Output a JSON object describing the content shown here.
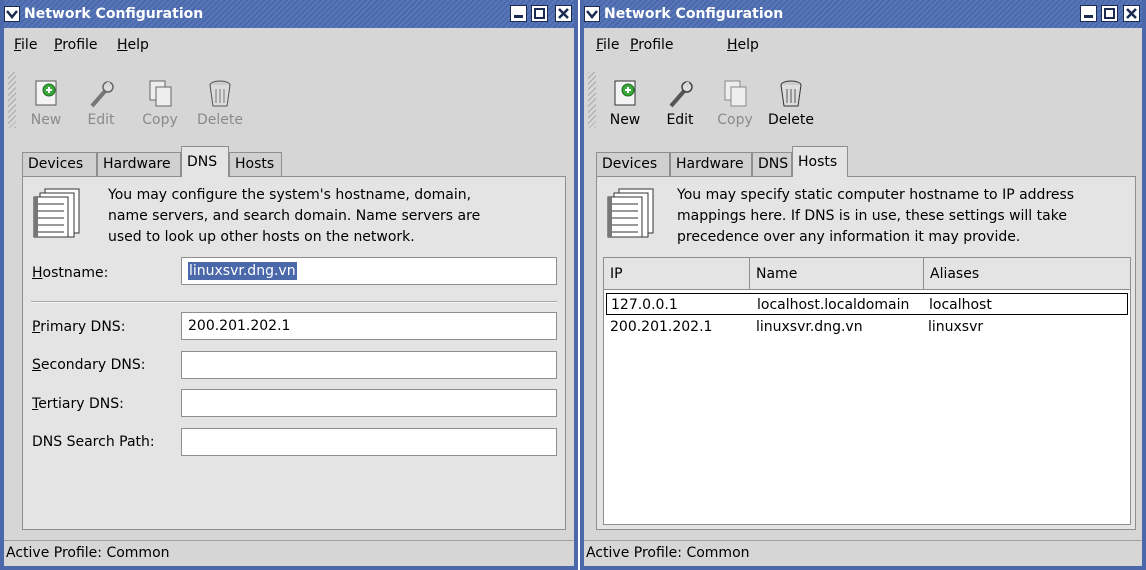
{
  "left_window": {
    "title": "Network Configuration",
    "menu": [
      {
        "label": "File",
        "key": "F",
        "rest": "ile"
      },
      {
        "label": "Profile",
        "key": "P",
        "rest": "rofile"
      },
      {
        "label": "Help",
        "key": "H",
        "rest": "elp"
      }
    ],
    "toolbar": {
      "new": "New",
      "edit": "Edit",
      "copy": "Copy",
      "delete": "Delete"
    },
    "tabs": [
      "Devices",
      "Hardware",
      "DNS",
      "Hosts"
    ],
    "active_tab": "DNS",
    "info_lines": [
      "You may configure the system's hostname, domain,",
      "name servers, and search domain. Name servers are",
      "used to look up other hosts on the network."
    ],
    "form": {
      "hostname_label": "Hostname:",
      "hostname_value": "linuxsvr.dng.vn",
      "primary_label": "Primary DNS:",
      "primary_value": "200.201.202.1",
      "secondary_label": "Secondary DNS:",
      "secondary_value": "",
      "tertiary_label": "Tertiary DNS:",
      "tertiary_value": "",
      "search_label": "DNS Search Path:",
      "search_value": ""
    },
    "status": "Active Profile: Common"
  },
  "right_window": {
    "title": "Network Configuration",
    "menu": [
      {
        "label": "File",
        "key": "F",
        "rest": "ile"
      },
      {
        "label": "Profile",
        "key": "P",
        "rest": "rofile"
      },
      {
        "label": "Help",
        "key": "H",
        "rest": "elp"
      }
    ],
    "toolbar": {
      "new": "New",
      "edit": "Edit",
      "copy": "Copy",
      "delete": "Delete"
    },
    "tabs": [
      "Devices",
      "Hardware",
      "DNS",
      "Hosts"
    ],
    "active_tab": "Hosts",
    "info_lines": [
      "You may specify static computer hostname to IP address",
      "mappings here.  If DNS is in use, these settings will take",
      "precedence over any information it may provide."
    ],
    "table": {
      "columns": [
        "IP",
        "Name",
        "Aliases"
      ],
      "rows": [
        {
          "ip": "127.0.0.1",
          "name": "localhost.localdomain",
          "aliases": "localhost"
        },
        {
          "ip": "200.201.202.1",
          "name": "linuxsvr.dng.vn",
          "aliases": "linuxsvr"
        }
      ]
    },
    "status": "Active Profile: Common"
  },
  "colors": {
    "titlebar": "#4a68aa",
    "panel": "#e4e4e4",
    "selection": "#4a68aa"
  }
}
